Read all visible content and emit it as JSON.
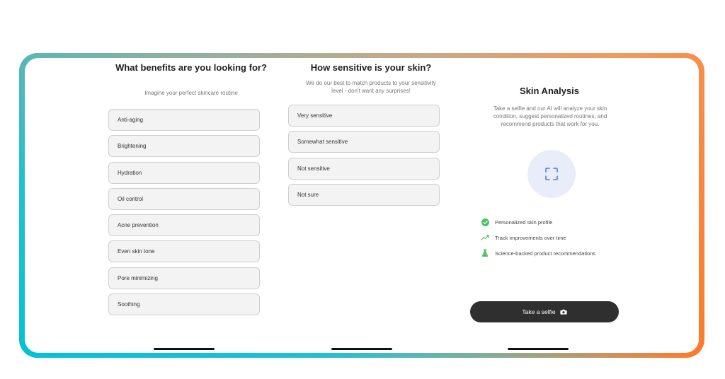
{
  "benefits": {
    "title": "What benefits are you looking for?",
    "subtitle": "Imagine your perfect skincare routine",
    "options": [
      "Anti-aging",
      "Brightening",
      "Hydration",
      "Oil control",
      "Acne prevention",
      "Even skin tone",
      "Pore minimizing",
      "Soothing"
    ]
  },
  "sensitivity": {
    "title": "How sensitive is your skin?",
    "subtitle": "We do our best to match products to your sensitivity level - don't want any surprises!",
    "options": [
      "Very sensitive",
      "Somewhat sensitive",
      "Not sensitive",
      "Not sure"
    ]
  },
  "analysis": {
    "title": "Skin Analysis",
    "subtitle": "Take a selfie and our AI will analyze your skin condition, suggest personalized routines, and recommend products that work for you.",
    "features": [
      {
        "label": "Personalized skin profile",
        "icon": "check-circle-icon"
      },
      {
        "label": "Track improvements over time",
        "icon": "trend-up-icon"
      },
      {
        "label": "Science-backed product recommendations",
        "icon": "flask-icon"
      }
    ],
    "cta_label": "Take a selfie",
    "cta_icon": "camera-icon"
  },
  "colors": {
    "accent_green": "#4cc36b",
    "scan_blue": "#4f7be8",
    "cta_bg": "#2f2f2f"
  }
}
